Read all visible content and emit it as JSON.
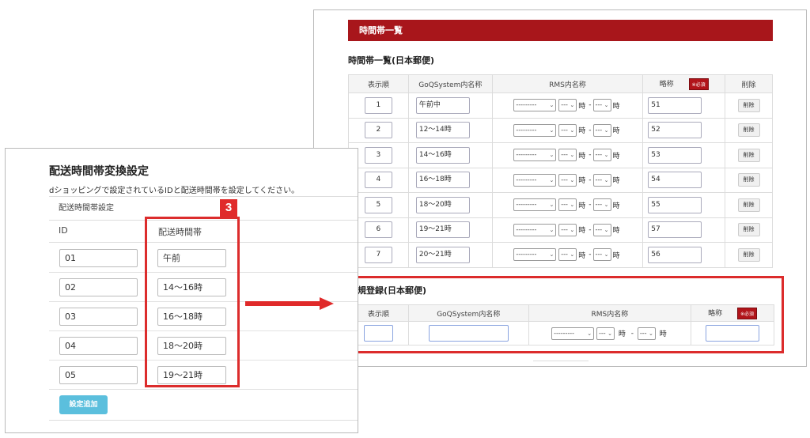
{
  "right_panel": {
    "header": "時間帯一覧",
    "subtitle": "時間帯一覧(日本郵便)",
    "columns": {
      "order": "表示順",
      "system_name": "GoQSystem内名称",
      "rms_name": "RMS内名称",
      "abbr": "略称",
      "required_badge": "※必須",
      "delete": "削除"
    },
    "hour_label": "時",
    "dash": "-",
    "select_default": "---------",
    "select_short": "---",
    "delete_button": "削除",
    "rows": [
      {
        "order": "1",
        "name": "午前中",
        "abbr": "51"
      },
      {
        "order": "2",
        "name": "12〜14時",
        "abbr": "52"
      },
      {
        "order": "3",
        "name": "14〜16時",
        "abbr": "53"
      },
      {
        "order": "4",
        "name": "16〜18時",
        "abbr": "54"
      },
      {
        "order": "5",
        "name": "18〜20時",
        "abbr": "55"
      },
      {
        "order": "6",
        "name": "19〜21時",
        "abbr": "57"
      },
      {
        "order": "7",
        "name": "20〜21時",
        "abbr": "56"
      }
    ]
  },
  "new_registration": {
    "title": "新規登録(日本郵便)",
    "columns": {
      "order": "表示順",
      "system_name": "GoQSystem内名称",
      "rms_name": "RMS内名称",
      "abbr": "略称",
      "required_badge": "※必須"
    }
  },
  "left_panel": {
    "title": "配送時間帯変換設定",
    "description": "dショッピングで設定されているIDと配送時間帯を設定してください。",
    "section_label": "配送時間帯設定",
    "col_id": "ID",
    "col_slot": "配送時間帯",
    "rows": [
      {
        "id": "01",
        "slot": "午前"
      },
      {
        "id": "02",
        "slot": "14〜16時"
      },
      {
        "id": "03",
        "slot": "16〜18時"
      },
      {
        "id": "04",
        "slot": "18〜20時"
      },
      {
        "id": "05",
        "slot": "19〜21時"
      }
    ],
    "add_button": "設定追加"
  },
  "step_number": "3",
  "colors": {
    "header_red": "#a8161b",
    "highlight_red": "#dc2c2c",
    "add_button_blue": "#5bbfdd"
  }
}
